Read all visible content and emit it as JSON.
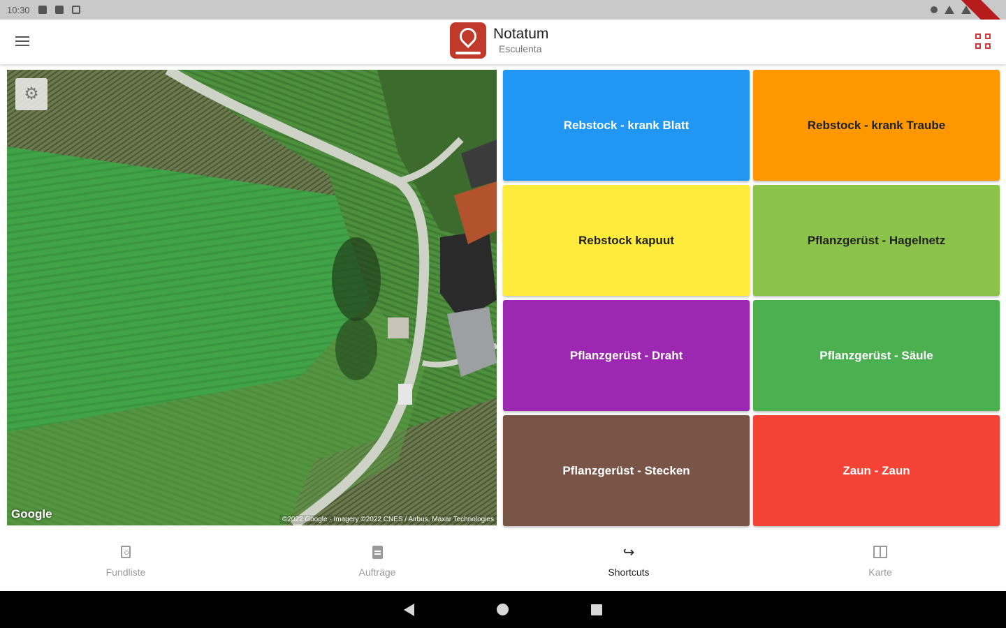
{
  "status_bar": {
    "time": "10:30"
  },
  "app_bar": {
    "title": "Notatum",
    "subtitle": "Esculenta"
  },
  "map": {
    "logo_text": "Google",
    "attribution": "©2022 Google · Imagery ©2022 CNES / Airbus, Maxar Technologies"
  },
  "shortcuts": [
    {
      "label": "Rebstock - krank Blatt",
      "color": "#2196f3",
      "text_color": "#ffffff"
    },
    {
      "label": "Rebstock - krank Traube",
      "color": "#ff9800",
      "text_color": "#222222"
    },
    {
      "label": "Rebstock kapuut",
      "color": "#ffeb3b",
      "text_color": "#222222"
    },
    {
      "label": "Pflanzgerüst - Hagelnetz",
      "color": "#8bc34a",
      "text_color": "#222222"
    },
    {
      "label": "Pflanzgerüst - Draht",
      "color": "#9c27b0",
      "text_color": "#ffffff"
    },
    {
      "label": "Pflanzgerüst - Säule",
      "color": "#4caf50",
      "text_color": "#ffffff"
    },
    {
      "label": "Pflanzgerüst - Stecken",
      "color": "#795548",
      "text_color": "#ffffff"
    },
    {
      "label": "Zaun - Zaun",
      "color": "#f44336",
      "text_color": "#ffffff"
    }
  ],
  "bottom_nav": {
    "items": [
      {
        "label": "Fundliste",
        "icon": "find-list-icon",
        "active": false
      },
      {
        "label": "Aufträge",
        "icon": "orders-icon",
        "active": false
      },
      {
        "label": "Shortcuts",
        "icon": "shortcut-arrow-icon",
        "active": true
      },
      {
        "label": "Karte",
        "icon": "map-icon",
        "active": false
      }
    ]
  },
  "colors": {
    "accent": "#d0393b",
    "status_bar": "#c9c9c9",
    "system_nav": "#000000"
  }
}
